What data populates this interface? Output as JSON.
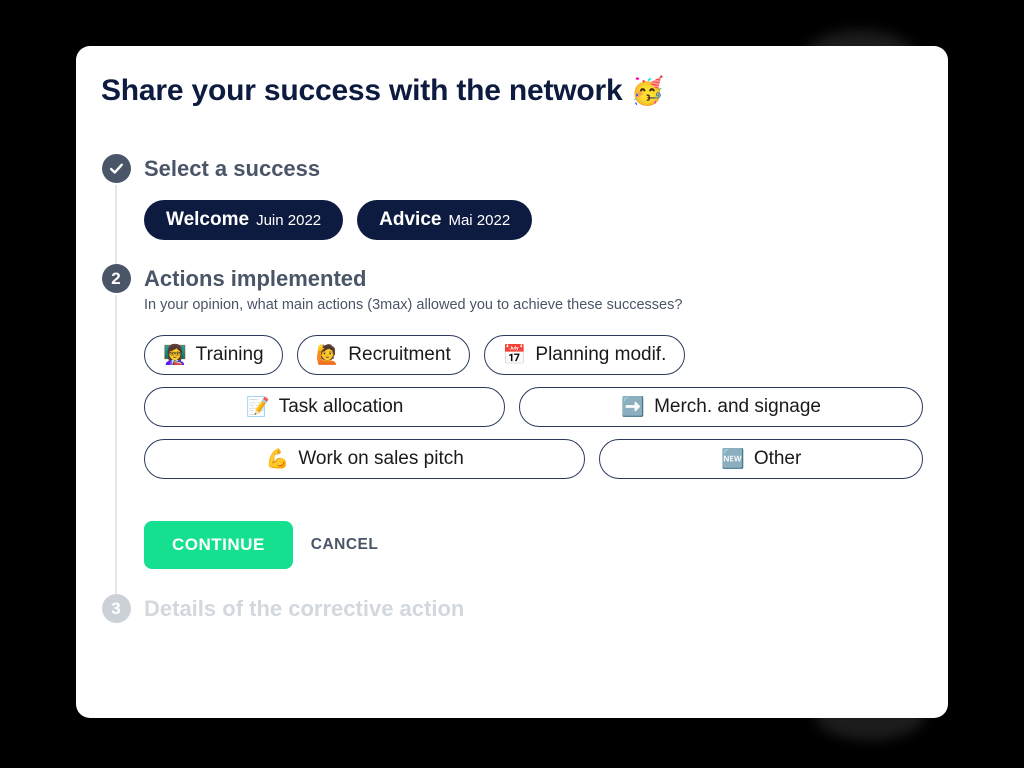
{
  "card": {
    "title": "Share your success with the network",
    "title_emoji": "🥳"
  },
  "steps": [
    {
      "marker": "check",
      "heading": "Select a success",
      "state": "completed"
    },
    {
      "marker": "2",
      "heading": "Actions implemented",
      "subtitle": "In your opinion, what main actions (3max) allowed you to achieve these successes?",
      "state": "active"
    },
    {
      "marker": "3",
      "heading": "Details of the corrective action",
      "state": "disabled"
    }
  ],
  "successes": [
    {
      "name": "Welcome",
      "date": "Juin 2022"
    },
    {
      "name": "Advice",
      "date": "Mai 2022"
    }
  ],
  "options": {
    "row1": [
      {
        "emoji": "👩‍🏫",
        "icon_name": "teacher-icon",
        "label": "Training"
      },
      {
        "emoji": "🙋",
        "icon_name": "raising-hand-icon",
        "label": "Recruitment"
      },
      {
        "emoji": "📅",
        "icon_name": "calendar-icon",
        "label": "Planning modif."
      }
    ],
    "row2": [
      {
        "emoji": "📝",
        "icon_name": "memo-icon",
        "label": "Task allocation"
      },
      {
        "emoji": "➡️",
        "icon_name": "right-arrow-icon",
        "label": "Merch. and signage"
      }
    ],
    "row3": [
      {
        "emoji": "💪",
        "icon_name": "flexed-biceps-icon",
        "label": "Work on sales pitch"
      },
      {
        "emoji": "🆕",
        "icon_name": "new-badge-icon",
        "label": "Other"
      }
    ]
  },
  "actions": {
    "continue_label": "CONTINUE",
    "cancel_label": "CANCEL"
  },
  "colors": {
    "brand_navy": "#0e1b40",
    "accent_green": "#14e08f",
    "step_slate": "#4a5568",
    "step_muted": "#ccd1d8",
    "page_background": "#000000",
    "card_background": "#ffffff"
  }
}
